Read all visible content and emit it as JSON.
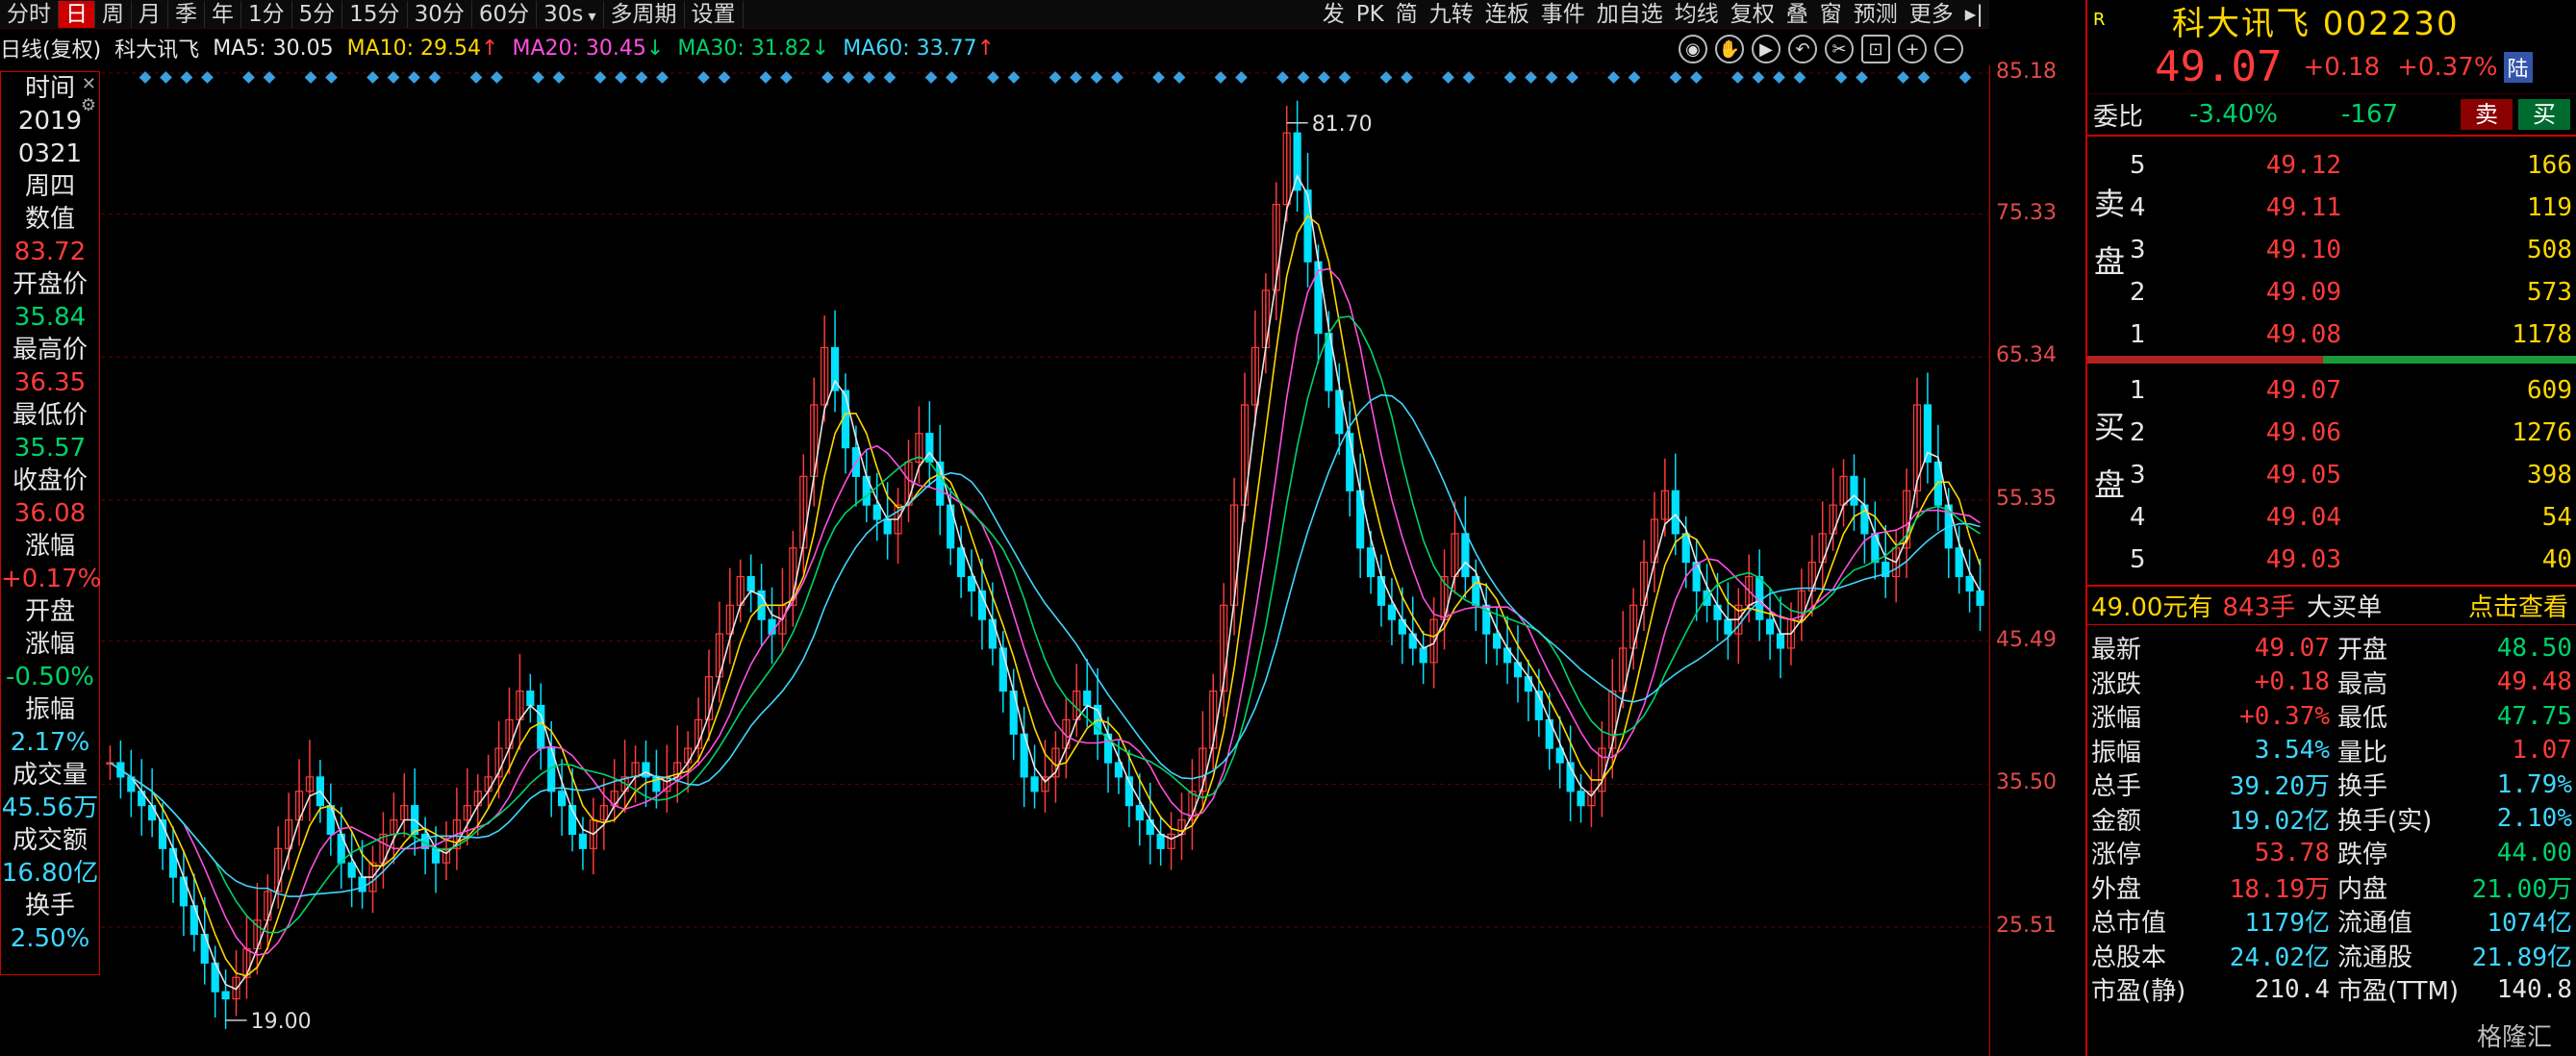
{
  "toolbar": {
    "periods": [
      "分时",
      "日",
      "周",
      "月",
      "季",
      "年",
      "1分",
      "5分",
      "15分",
      "30分",
      "60分",
      "30s",
      "多周期",
      "设置"
    ],
    "active_period": "日",
    "right_tools": [
      "发",
      "PK",
      "简",
      "九转",
      "连板",
      "事件",
      "加自选",
      "均线",
      "复权",
      "叠",
      "窗",
      "预测",
      "更多"
    ]
  },
  "ma_legend": {
    "title": "日线(复权)",
    "stock": "科大讯飞",
    "items": [
      {
        "label": "MA5: 30.05",
        "color": "#e6e6e6",
        "dir": ""
      },
      {
        "label": "MA10: 29.54",
        "color": "#ffd700",
        "dir": "up"
      },
      {
        "label": "MA20: 30.45",
        "color": "#ff4fe0",
        "dir": "dn"
      },
      {
        "label": "MA30: 31.82",
        "color": "#00d26a",
        "dir": "dn"
      },
      {
        "label": "MA60: 33.77",
        "color": "#3fd7ff",
        "dir": "up"
      }
    ]
  },
  "chart_icons": [
    "eye-icon",
    "hand-icon",
    "play-icon",
    "undo-icon",
    "scissors-icon",
    "lock-icon",
    "zoom-in-icon",
    "zoom-out-icon"
  ],
  "info_panel": [
    {
      "label": "时间",
      "value": ""
    },
    {
      "label": "",
      "value": "2019",
      "cls": "white"
    },
    {
      "label": "",
      "value": "0321",
      "cls": "white"
    },
    {
      "label": "",
      "value": "周四",
      "cls": "white"
    },
    {
      "label": "数值",
      "value": ""
    },
    {
      "label": "",
      "value": "83.72",
      "cls": "red"
    },
    {
      "label": "开盘价",
      "value": ""
    },
    {
      "label": "",
      "value": "35.84",
      "cls": "green"
    },
    {
      "label": "最高价",
      "value": ""
    },
    {
      "label": "",
      "value": "36.35",
      "cls": "red"
    },
    {
      "label": "最低价",
      "value": ""
    },
    {
      "label": "",
      "value": "35.57",
      "cls": "green"
    },
    {
      "label": "收盘价",
      "value": ""
    },
    {
      "label": "",
      "value": "36.08",
      "cls": "red"
    },
    {
      "label": "涨幅",
      "value": ""
    },
    {
      "label": "",
      "value": "+0.17%",
      "cls": "red"
    },
    {
      "label": "开盘",
      "value": ""
    },
    {
      "label": "涨幅",
      "value": ""
    },
    {
      "label": "",
      "value": "-0.50%",
      "cls": "green"
    },
    {
      "label": "振幅",
      "value": ""
    },
    {
      "label": "",
      "value": "2.17%",
      "cls": "cyan"
    },
    {
      "label": "成交量",
      "value": ""
    },
    {
      "label": "",
      "value": "45.56万",
      "cls": "cyan"
    },
    {
      "label": "成交额",
      "value": ""
    },
    {
      "label": "",
      "value": "16.80亿",
      "cls": "cyan"
    },
    {
      "label": "换手",
      "value": ""
    },
    {
      "label": "",
      "value": "2.50%",
      "cls": "cyan"
    }
  ],
  "chart_data": {
    "type": "line",
    "y_ticks": [
      "85.18",
      "75.33",
      "65.34",
      "55.35",
      "45.49",
      "35.50",
      "25.51"
    ],
    "ylim": [
      25.51,
      85.18
    ],
    "annotations": [
      {
        "text": "81.70",
        "value": 81.7
      },
      {
        "text": "19.00",
        "value": 19.0
      }
    ],
    "ma_colors": {
      "MA5": "#e6e6e6",
      "MA10": "#ffd700",
      "MA20": "#ff4fe0",
      "MA30": "#00d26a",
      "MA60": "#3fd7ff"
    },
    "close_series": [
      37,
      36,
      35,
      34,
      33,
      31,
      29,
      27,
      25,
      23,
      21,
      20.5,
      22,
      24,
      26,
      28,
      31,
      33,
      35,
      36,
      34,
      32,
      30,
      29,
      28,
      30,
      32,
      33,
      34,
      32,
      31,
      30,
      31,
      33,
      34,
      35,
      36,
      38,
      40,
      42,
      41,
      38,
      35,
      34,
      32,
      31,
      33,
      34,
      35,
      36,
      37,
      36,
      35,
      36,
      37,
      38,
      40,
      43,
      46,
      48,
      50,
      49,
      47,
      46,
      48,
      52,
      57,
      62,
      66,
      63,
      59,
      57,
      55,
      54,
      53,
      55,
      58,
      60,
      58,
      55,
      52,
      50,
      49,
      47,
      45,
      42,
      39,
      36,
      35,
      36,
      38,
      40,
      42,
      41,
      39,
      37,
      36,
      34,
      33,
      32,
      31,
      32,
      33,
      35,
      38,
      42,
      48,
      55,
      62,
      66,
      70,
      76,
      81,
      77,
      72,
      67,
      63,
      60,
      56,
      52,
      50,
      48,
      47,
      46,
      45,
      44,
      47,
      50,
      53,
      50,
      48,
      46,
      45,
      44,
      43,
      42,
      40,
      38,
      37,
      35,
      34,
      35,
      38,
      42,
      45,
      48,
      51,
      54,
      56,
      53,
      51,
      49,
      48,
      47,
      46,
      48,
      50,
      47,
      46,
      45,
      47,
      49,
      51,
      53,
      55,
      57,
      55,
      53,
      51,
      50,
      52,
      56,
      62,
      58,
      55,
      52,
      50,
      49,
      48
    ]
  },
  "panel": {
    "badge": "R",
    "name": "科大讯飞 002230",
    "price": "49.07",
    "change": "+0.18",
    "change_pct": "+0.37%",
    "lu": "陆",
    "weibi_label": "委比",
    "weibi_pct": "-3.40%",
    "weibi_diff": "-167",
    "buy_label": "买",
    "sell_label": "卖",
    "sell_side_label": [
      "卖",
      "盘"
    ],
    "buy_side_label": [
      "买",
      "盘"
    ],
    "asks": [
      {
        "lvl": "5",
        "px": "49.12",
        "vol": "166"
      },
      {
        "lvl": "4",
        "px": "49.11",
        "vol": "119"
      },
      {
        "lvl": "3",
        "px": "49.10",
        "vol": "508"
      },
      {
        "lvl": "2",
        "px": "49.09",
        "vol": "573"
      },
      {
        "lvl": "1",
        "px": "49.08",
        "vol": "1178"
      }
    ],
    "bids": [
      {
        "lvl": "1",
        "px": "49.07",
        "vol": "609"
      },
      {
        "lvl": "2",
        "px": "49.06",
        "vol": "1276"
      },
      {
        "lvl": "3",
        "px": "49.05",
        "vol": "398"
      },
      {
        "lvl": "4",
        "px": "49.04",
        "vol": "54"
      },
      {
        "lvl": "5",
        "px": "49.03",
        "vol": "40"
      }
    ],
    "big_order": {
      "price": "49.00元有",
      "qty": "843手",
      "text": "大买单",
      "link": "点击查看"
    },
    "stats": [
      {
        "l1": "最新",
        "v1": "49.07",
        "c1": "red",
        "l2": "开盘",
        "v2": "48.50",
        "c2": "green"
      },
      {
        "l1": "涨跌",
        "v1": "+0.18",
        "c1": "red",
        "l2": "最高",
        "v2": "49.48",
        "c2": "red"
      },
      {
        "l1": "涨幅",
        "v1": "+0.37%",
        "c1": "red",
        "l2": "最低",
        "v2": "47.75",
        "c2": "green"
      },
      {
        "l1": "振幅",
        "v1": "3.54%",
        "c1": "cyan",
        "l2": "量比",
        "v2": "1.07",
        "c2": "red"
      },
      {
        "l1": "总手",
        "v1": "39.20万",
        "c1": "cyan",
        "l2": "换手",
        "v2": "1.79%",
        "c2": "cyan"
      },
      {
        "l1": "金额",
        "v1": "19.02亿",
        "c1": "cyan",
        "l2": "换手(实)",
        "v2": "2.10%",
        "c2": "cyan"
      },
      {
        "l1": "涨停",
        "v1": "53.78",
        "c1": "red",
        "l2": "跌停",
        "v2": "44.00",
        "c2": "green"
      },
      {
        "l1": "外盘",
        "v1": "18.19万",
        "c1": "red",
        "l2": "内盘",
        "v2": "21.00万",
        "c2": "green"
      },
      {
        "l1": "总市值",
        "v1": "1179亿",
        "c1": "cyan",
        "l2": "流通值",
        "v2": "1074亿",
        "c2": "cyan"
      },
      {
        "l1": "总股本",
        "v1": "24.02亿",
        "c1": "cyan",
        "l2": "流通股",
        "v2": "21.89亿",
        "c2": "cyan"
      },
      {
        "l1": "市盈(静)",
        "v1": "210.4",
        "c1": "white",
        "l2": "市盈(TTM)",
        "v2": "140.8",
        "c2": "white"
      }
    ],
    "watermark": "格隆汇"
  }
}
